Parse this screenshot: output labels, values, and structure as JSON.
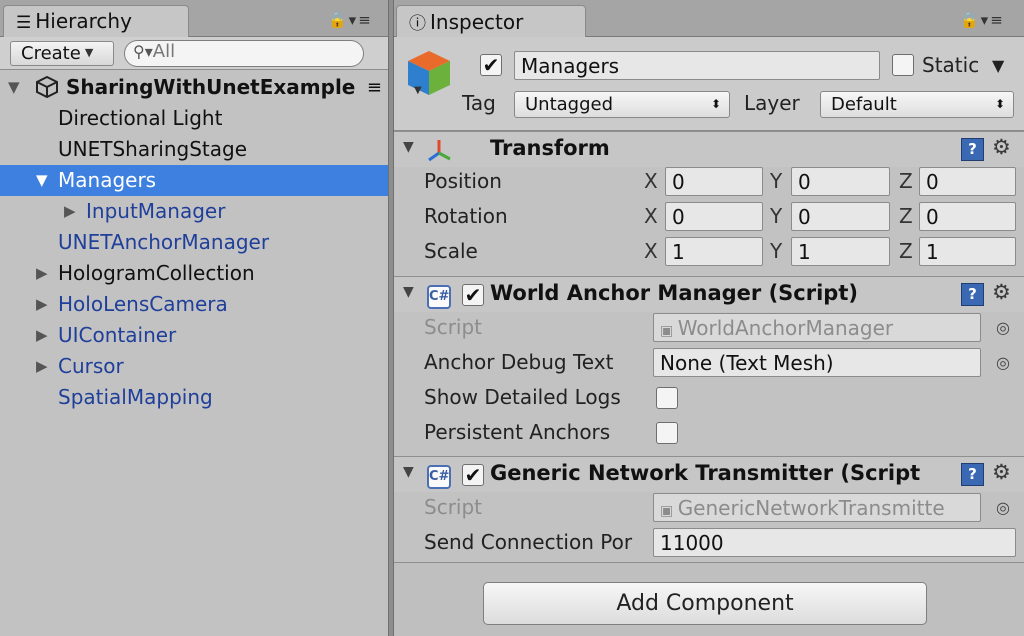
{
  "hierarchy": {
    "tab_label": "Hierarchy",
    "create_label": "Create",
    "search_placeholder": "All",
    "scene_name": "SharingWithUnetExample",
    "items": [
      {
        "label": "Directional Light"
      },
      {
        "label": "UNETSharingStage"
      },
      {
        "label": "Managers"
      },
      {
        "label": "InputManager"
      },
      {
        "label": "UNETAnchorManager"
      },
      {
        "label": "HologramCollection"
      },
      {
        "label": "HoloLensCamera"
      },
      {
        "label": "UIContainer"
      },
      {
        "label": "Cursor"
      },
      {
        "label": "SpatialMapping"
      }
    ]
  },
  "inspector": {
    "tab_label": "Inspector",
    "object_name": "Managers",
    "static_label": "Static",
    "tag_label": "Tag",
    "tag_value": "Untagged",
    "layer_label": "Layer",
    "layer_value": "Default",
    "transform": {
      "title": "Transform",
      "axis_x": "X",
      "axis_y": "Y",
      "axis_z": "Z",
      "rows": [
        {
          "label": "Position",
          "x": "0",
          "y": "0",
          "z": "0"
        },
        {
          "label": "Rotation",
          "x": "0",
          "y": "0",
          "z": "0"
        },
        {
          "label": "Scale",
          "x": "1",
          "y": "1",
          "z": "1"
        }
      ]
    },
    "world_anchor": {
      "title": "World Anchor Manager (Script)",
      "script_label": "Script",
      "script_value": "WorldAnchorManager",
      "debug_text_label": "Anchor Debug Text",
      "debug_text_value": "None (Text Mesh)",
      "logs_label": "Show Detailed Logs",
      "persistent_label": "Persistent Anchors"
    },
    "transmitter": {
      "title": "Generic Network Transmitter (Script",
      "script_label": "Script",
      "script_value": "GenericNetworkTransmitte",
      "port_label": "Send Connection Por",
      "port_value": "11000"
    },
    "add_component_label": "Add Component"
  },
  "colors": {
    "selection": "#3d80df",
    "prefab_text": "#1f3f9a",
    "help_icon": "#3a68b3"
  }
}
